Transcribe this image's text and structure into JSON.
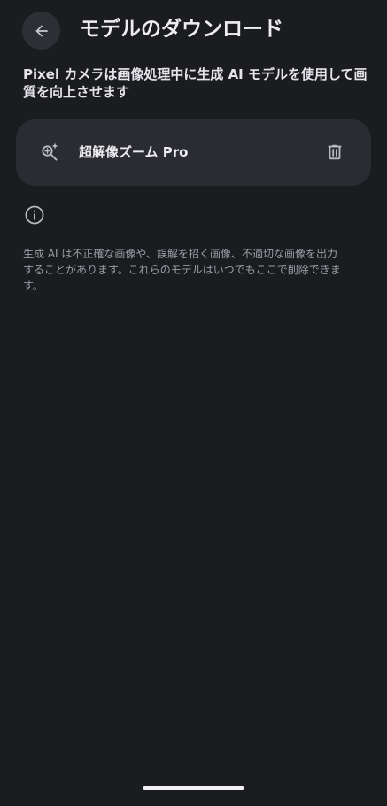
{
  "header": {
    "title": "モデルのダウンロード"
  },
  "description": "Pixel カメラは画像処理中に生成 AI モデルを使用して画質を向上させます",
  "models": [
    {
      "name": "超解像ズーム Pro",
      "icon": "zoom-sparkle-icon",
      "action_icon": "trash-icon"
    }
  ],
  "info": {
    "icon": "info-icon",
    "disclaimer": "生成 AI は不正確な画像や、誤解を招く画像、不適切な画像を出力することがあります。これらのモデルはいつでもここで削除できます。"
  },
  "colors": {
    "background": "#1b1c20",
    "card": "#2a2c32",
    "back_button": "#2d2f35",
    "primary_text": "#e6e6ea",
    "secondary_text": "#9c9ea6",
    "icon": "#b8bac2"
  }
}
